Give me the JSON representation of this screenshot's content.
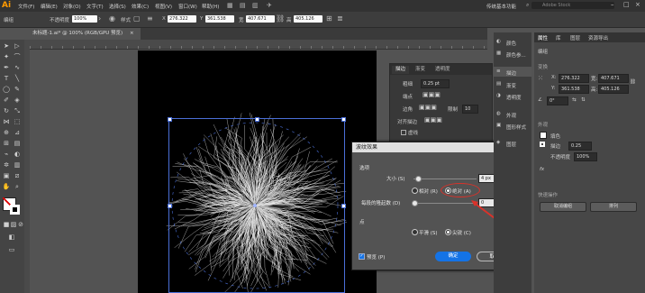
{
  "menubar": {
    "logo": "Ai",
    "items": [
      "文件(F)",
      "编辑(E)",
      "对象(O)",
      "文字(T)",
      "选择(S)",
      "效果(C)",
      "视图(V)",
      "窗口(W)",
      "帮助(H)"
    ],
    "workspace": "传统基本功能",
    "search_placeholder": "Adobe Stock"
  },
  "control_bar": {
    "group_label": "编组",
    "opacity_label": "不透明度",
    "opacity_value": "100%",
    "style_label": "样式",
    "x_label": "X",
    "x_value": "276.322",
    "y_label": "Y",
    "y_value": "361.538",
    "w_label": "宽",
    "w_value": "407.671",
    "h_label": "高",
    "h_value": "405.126"
  },
  "document_tab": {
    "title": "未标题-1.ai* @ 100% (RGB/GPU 预览)",
    "close": "×"
  },
  "stroke_panel": {
    "tabs": [
      "描边",
      "渐变",
      "透明度"
    ],
    "weight_label": "粗细",
    "weight_value": "0.25 pt",
    "cap_label": "端点",
    "corner_label": "边角",
    "limit_label": "限制",
    "limit_value": "10",
    "align_label": "对齐描边",
    "dashed_label": "虚线"
  },
  "dialog": {
    "title": "波纹效果",
    "options_label": "选项",
    "size_label": "大小 (S)",
    "size_value": "4 px",
    "size_fraction": 0.05,
    "relative_label": "相对 (R)",
    "absolute_label": "绝对 (A)",
    "ridges_label": "每段的隆起数 (D)",
    "ridges_value": "0",
    "points_label": "点",
    "smooth_label": "平滑 (S)",
    "corner_label": "尖锐 (C)",
    "preview_label": "预览 (P)",
    "ok_label": "确定",
    "cancel_label": "取消"
  },
  "icon_strip": {
    "items": [
      "颜色",
      "颜色参...",
      "描边",
      "渐变",
      "透明度",
      "外观",
      "图形样式",
      "图层"
    ]
  },
  "properties": {
    "tabs": [
      "属性",
      "库",
      "图层",
      "资源导出"
    ],
    "section_group": "编组",
    "transform_label": "变换",
    "x_value": "276.322",
    "y_value": "361.538",
    "w_value": "407.671",
    "h_value": "405.126",
    "angle_value": "0°",
    "appearance_label": "外观",
    "fill_label": "填色",
    "stroke_label": "描边",
    "stroke_value": "0.25",
    "opacity_label": "不透明度",
    "opacity_value": "100%",
    "fx_label": "fx",
    "quick_actions_label": "快速操作",
    "ungroup_label": "取消编组",
    "arrange_label": "排列"
  },
  "colors": {
    "accent": "#1473e6",
    "highlight_circle": "#d9322a",
    "selection": "#4a6fd8"
  }
}
